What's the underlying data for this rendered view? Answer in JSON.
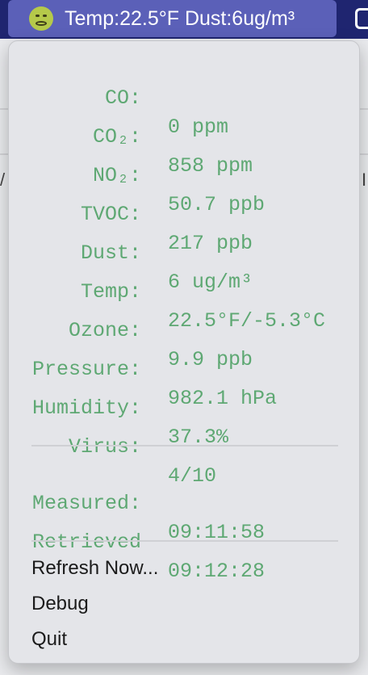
{
  "menubar": {
    "status_text": "Temp:22.5°F Dust:6ug/m³",
    "emoji_icon": "nauseated-face-icon"
  },
  "menu": {
    "readings": [
      {
        "label": "CO:",
        "value": "0 ppm"
      },
      {
        "label": "CO₂:",
        "value": "858 ppm"
      },
      {
        "label": "NO₂:",
        "value": "50.7 ppb"
      },
      {
        "label": "TVOC:",
        "value": "217 ppb"
      },
      {
        "label": "Dust:",
        "value": "6 ug/m³"
      },
      {
        "label": "Temp:",
        "value": "22.5°F/-5.3°C"
      },
      {
        "label": "Ozone:",
        "value": "9.9 ppb"
      },
      {
        "label": "Pressure:",
        "value": "982.1 hPa"
      },
      {
        "label": "Humidity:",
        "value": "37.3%"
      },
      {
        "label": "Virus:",
        "value": "4/10"
      }
    ],
    "times": [
      {
        "label": "Measured:",
        "value": "09:11:58"
      },
      {
        "label": "Retrieved",
        "value": "09:12:28"
      }
    ],
    "actions": {
      "refresh": "Refresh Now...",
      "debug": "Debug",
      "quit": "Quit"
    }
  },
  "background": {
    "left_fragment": "/",
    "right_fragment": "I"
  },
  "colors": {
    "reading_text": "#5ea873",
    "menubar_bg": "#1f2570",
    "status_item_bg": "#5b60b8"
  }
}
